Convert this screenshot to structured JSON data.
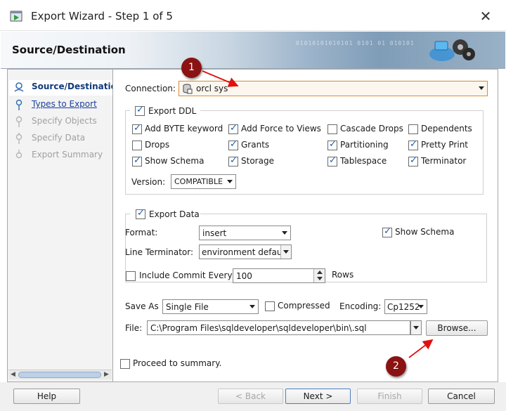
{
  "window": {
    "title": "Export Wizard - Step 1 of 5"
  },
  "banner": {
    "title": "Source/Destination",
    "binary_text": "01010101010101 0101 01 010101"
  },
  "nav": {
    "items": [
      {
        "label": "Source/Destination",
        "state": "active"
      },
      {
        "label": "Types to Export",
        "state": "link"
      },
      {
        "label": "Specify Objects",
        "state": "disabled"
      },
      {
        "label": "Specify Data",
        "state": "disabled"
      },
      {
        "label": "Export Summary",
        "state": "disabled"
      }
    ]
  },
  "connection": {
    "label": "Connection:",
    "value": "orcl sys"
  },
  "export_ddl": {
    "label": "Export DDL",
    "checked": true,
    "options": [
      {
        "label": "Add BYTE keyword",
        "checked": true
      },
      {
        "label": "Add Force to Views",
        "checked": true
      },
      {
        "label": "Cascade Drops",
        "checked": false
      },
      {
        "label": "Dependents",
        "checked": false
      },
      {
        "label": "Drops",
        "checked": false
      },
      {
        "label": "Grants",
        "checked": true
      },
      {
        "label": "Partitioning",
        "checked": true
      },
      {
        "label": "Pretty Print",
        "checked": true
      },
      {
        "label": "Show Schema",
        "checked": true
      },
      {
        "label": "Storage",
        "checked": true
      },
      {
        "label": "Tablespace",
        "checked": true
      },
      {
        "label": "Terminator",
        "checked": true
      }
    ],
    "version_label": "Version:",
    "version_value": "COMPATIBLE"
  },
  "export_data": {
    "label": "Export Data",
    "checked": true,
    "format_label": "Format:",
    "format_value": "insert",
    "show_schema_label": "Show Schema",
    "show_schema_checked": true,
    "line_terminator_label": "Line Terminator:",
    "line_terminator_value": "environment default",
    "include_commit_label": "Include Commit Every",
    "include_commit_checked": false,
    "commit_value": "100",
    "rows_label": "Rows"
  },
  "output": {
    "save_as_label": "Save As",
    "save_as_value": "Single File",
    "compressed_label": "Compressed",
    "compressed_checked": false,
    "encoding_label": "Encoding:",
    "encoding_value": "Cp1252",
    "file_label": "File:",
    "file_value": "C:\\Program Files\\sqldeveloper\\sqldeveloper\\bin\\.sql",
    "browse_label": "Browse..."
  },
  "proceed": {
    "label": "Proceed to summary.",
    "checked": false
  },
  "callouts": [
    "1",
    "2"
  ],
  "buttons": {
    "help": "Help",
    "back": "< Back",
    "next": "Next >",
    "finish": "Finish",
    "cancel": "Cancel"
  },
  "colors": {
    "callout": "#8b1212",
    "arrow": "#e01010",
    "link": "#1b3f9a"
  }
}
